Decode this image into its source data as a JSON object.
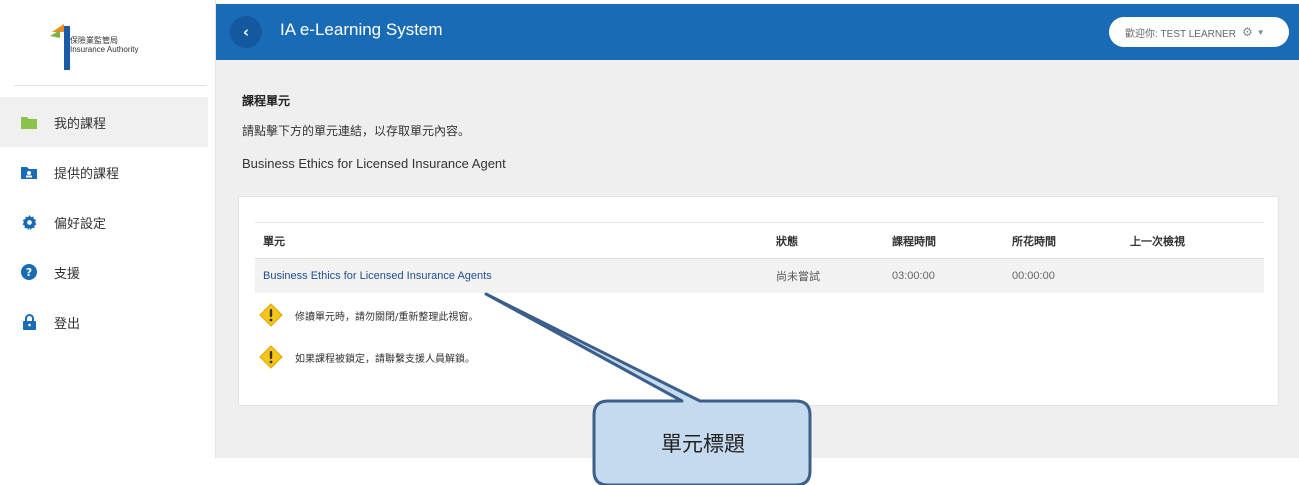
{
  "logo": {
    "name_zh": "保險業監管局",
    "name_en": "Insurance Authority"
  },
  "sidebar": {
    "items": [
      {
        "label": "我的課程",
        "icon": "folder-icon",
        "active": true
      },
      {
        "label": "提供的課程",
        "icon": "folder-person-icon",
        "active": false
      },
      {
        "label": "偏好設定",
        "icon": "gear-icon",
        "active": false
      },
      {
        "label": "支援",
        "icon": "help-icon",
        "active": false
      },
      {
        "label": "登出",
        "icon": "lock-icon",
        "active": false
      }
    ]
  },
  "header": {
    "title": "IA e-Learning System",
    "back_glyph": "‹",
    "user_greeting": "歡迎你: TEST LEARNER",
    "bg_color": "#1a6bb5"
  },
  "main": {
    "section_title": "課程單元",
    "section_desc": "請點擊下方的單元連結，以存取單元內容。",
    "course_name": "Business Ethics for Licensed Insurance Agent",
    "table": {
      "headers": [
        "單元",
        "狀態",
        "課程時間",
        "所花時間",
        "上一次檢視"
      ],
      "rows": [
        {
          "unit": "Business Ethics for Licensed Insurance Agents",
          "status": "尚未嘗試",
          "duration": "03:00:00",
          "time_spent": "00:00:00",
          "last_viewed": ""
        }
      ]
    },
    "notes": [
      "修讀單元時，請勿關閉/重新整理此視窗。",
      "如果課程被鎖定，請聯繫支援人員解鎖。"
    ]
  },
  "callout": {
    "label": "單元標題",
    "fill": "#c5d9ef",
    "stroke": "#3b5f8a"
  }
}
